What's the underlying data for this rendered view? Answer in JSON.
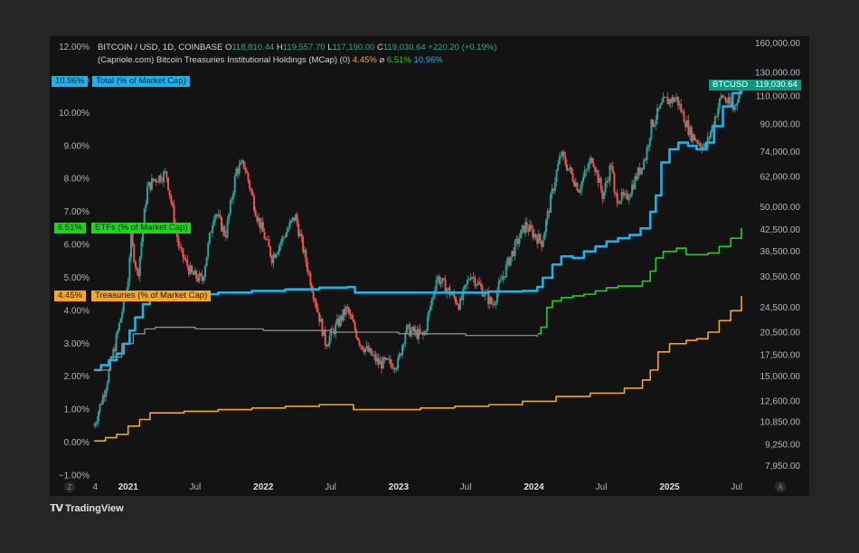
{
  "legend": {
    "line1": {
      "symbol": "BITCOIN / USD, 1D, COINBASE",
      "o_label": "O",
      "o_value": "118,810.44",
      "h_label": "H",
      "h_value": "119,557.70",
      "l_label": "L",
      "l_value": "117,190.00",
      "c_label": "C",
      "c_value": "119,030.64",
      "change": "+220.20 (+0.19%)"
    },
    "line2": {
      "indicator": "(Capriole.com) Bitcoin Treasuries Institutional Holdings (MCap) (0)",
      "v1": "4.45%",
      "sep": "⌀",
      "v2": "6.51%",
      "v3": "10.96%"
    }
  },
  "tags": {
    "total": {
      "value": "10.96%",
      "label": "Total (% of Market Cap)"
    },
    "etf": {
      "value": "6.51%",
      "label": "ETFs (% of Market Cap)"
    },
    "treasury": {
      "value": "4.45%",
      "label": "Treasuries (% of Market Cap)"
    },
    "btc": {
      "symbol": "BTCUSD",
      "value": "119,030.64"
    }
  },
  "brand": "TradingView",
  "nav": {
    "left": "Z",
    "right": "A"
  },
  "colors": {
    "total": "#1eb2ea",
    "etf": "#21d321",
    "treasury": "#f5a623",
    "grey": "#8c8c8c",
    "up": "#26a69a",
    "down": "#ef5350",
    "btc_tag": "#089981"
  },
  "chart_data": {
    "type": "line",
    "x_axis": {
      "labels": [
        "4",
        "2021",
        "Jul",
        "2022",
        "Jul",
        "2023",
        "Jul",
        "2024",
        "Jul",
        "2025",
        "Jul"
      ],
      "range": [
        "2020-10-01",
        "2025-07-14"
      ]
    },
    "left_axis": {
      "ticks": [
        "12.00%",
        "11.00%",
        "10.00%",
        "9.00%",
        "8.00%",
        "7.00%",
        "6.00%",
        "5.00%",
        "4.00%",
        "3.00%",
        "2.00%",
        "1.00%",
        "0.00%",
        "−1.00%"
      ],
      "range": [
        -1,
        12
      ]
    },
    "right_axis": {
      "scale": "log",
      "ticks": [
        "160,000.00",
        "130,000.00",
        "110,000.00",
        "90,000.00",
        "74,000.00",
        "62,000.00",
        "50,000.00",
        "42,500.00",
        "36,500.00",
        "30,500.00",
        "24,500.00",
        "20,500.00",
        "17,500.00",
        "15,000.00",
        "12,600.00",
        "10,850.00",
        "9,250.00",
        "7,950.00"
      ]
    },
    "series": [
      {
        "name": "Total (% of Market Cap)",
        "axis": "left",
        "points": [
          [
            "2020-10-01",
            2.2
          ],
          [
            "2020-10-20",
            2.35
          ],
          [
            "2020-11-10",
            2.5
          ],
          [
            "2020-12-01",
            2.7
          ],
          [
            "2020-12-20",
            3.0
          ],
          [
            "2021-01-05",
            3.4
          ],
          [
            "2021-01-20",
            3.8
          ],
          [
            "2021-02-10",
            4.2
          ],
          [
            "2021-03-01",
            4.5
          ],
          [
            "2021-04-01",
            4.45
          ],
          [
            "2021-06-01",
            4.5
          ],
          [
            "2021-09-01",
            4.55
          ],
          [
            "2021-12-01",
            4.6
          ],
          [
            "2022-03-01",
            4.65
          ],
          [
            "2022-06-01",
            4.7
          ],
          [
            "2022-08-15",
            4.72
          ],
          [
            "2022-09-05",
            4.55
          ],
          [
            "2022-12-01",
            4.55
          ],
          [
            "2023-03-01",
            4.55
          ],
          [
            "2023-06-01",
            4.55
          ],
          [
            "2023-09-01",
            4.58
          ],
          [
            "2023-12-01",
            4.6
          ],
          [
            "2024-01-10",
            4.72
          ],
          [
            "2024-01-25",
            5.0
          ],
          [
            "2024-02-20",
            5.4
          ],
          [
            "2024-03-15",
            5.65
          ],
          [
            "2024-04-15",
            5.6
          ],
          [
            "2024-05-15",
            5.8
          ],
          [
            "2024-06-15",
            5.95
          ],
          [
            "2024-07-15",
            6.1
          ],
          [
            "2024-08-15",
            6.2
          ],
          [
            "2024-09-15",
            6.3
          ],
          [
            "2024-10-15",
            6.5
          ],
          [
            "2024-11-10",
            7.0
          ],
          [
            "2024-11-25",
            7.5
          ],
          [
            "2024-12-10",
            8.5
          ],
          [
            "2025-01-01",
            8.9
          ],
          [
            "2025-01-25",
            9.1
          ],
          [
            "2025-02-20",
            9.0
          ],
          [
            "2025-03-15",
            8.9
          ],
          [
            "2025-04-10",
            9.1
          ],
          [
            "2025-05-01",
            9.6
          ],
          [
            "2025-05-25",
            10.2
          ],
          [
            "2025-06-20",
            10.6
          ],
          [
            "2025-07-14",
            10.96
          ]
        ]
      },
      {
        "name": "ETFs (% of Market Cap)",
        "axis": "left",
        "points": [
          [
            "2024-01-11",
            3.3
          ],
          [
            "2024-01-20",
            3.5
          ],
          [
            "2024-02-05",
            4.1
          ],
          [
            "2024-02-20",
            4.3
          ],
          [
            "2024-03-15",
            4.4
          ],
          [
            "2024-04-15",
            4.45
          ],
          [
            "2024-05-15",
            4.5
          ],
          [
            "2024-06-15",
            4.6
          ],
          [
            "2024-07-15",
            4.7
          ],
          [
            "2024-08-15",
            4.75
          ],
          [
            "2024-09-15",
            4.75
          ],
          [
            "2024-10-20",
            4.9
          ],
          [
            "2024-11-10",
            5.2
          ],
          [
            "2024-11-25",
            5.6
          ],
          [
            "2024-12-15",
            5.8
          ],
          [
            "2025-01-20",
            5.9
          ],
          [
            "2025-02-15",
            5.7
          ],
          [
            "2025-03-15",
            5.7
          ],
          [
            "2025-04-15",
            5.75
          ],
          [
            "2025-05-15",
            5.95
          ],
          [
            "2025-06-15",
            6.2
          ],
          [
            "2025-07-14",
            6.51
          ]
        ]
      },
      {
        "name": "Treasuries (% of Market Cap)",
        "axis": "left",
        "points": [
          [
            "2020-10-01",
            0.05
          ],
          [
            "2020-11-01",
            0.15
          ],
          [
            "2020-12-01",
            0.25
          ],
          [
            "2021-01-01",
            0.5
          ],
          [
            "2021-02-01",
            0.7
          ],
          [
            "2021-03-01",
            0.9
          ],
          [
            "2021-06-01",
            0.95
          ],
          [
            "2021-09-01",
            1.0
          ],
          [
            "2021-12-01",
            1.05
          ],
          [
            "2022-03-01",
            1.1
          ],
          [
            "2022-06-01",
            1.15
          ],
          [
            "2022-09-01",
            1.0
          ],
          [
            "2022-12-01",
            1.0
          ],
          [
            "2023-03-01",
            1.05
          ],
          [
            "2023-06-01",
            1.1
          ],
          [
            "2023-09-01",
            1.15
          ],
          [
            "2023-12-01",
            1.25
          ],
          [
            "2024-03-01",
            1.4
          ],
          [
            "2024-06-01",
            1.5
          ],
          [
            "2024-09-01",
            1.65
          ],
          [
            "2024-10-20",
            1.9
          ],
          [
            "2024-11-10",
            2.2
          ],
          [
            "2024-12-01",
            2.75
          ],
          [
            "2025-01-01",
            3.0
          ],
          [
            "2025-02-15",
            3.1
          ],
          [
            "2025-03-15",
            3.15
          ],
          [
            "2025-04-15",
            3.35
          ],
          [
            "2025-05-15",
            3.7
          ],
          [
            "2025-06-15",
            4.0
          ],
          [
            "2025-07-14",
            4.45
          ]
        ]
      },
      {
        "name": "",
        "axis": "left",
        "points": [
          [
            "2020-10-01",
            2.2
          ],
          [
            "2020-11-15",
            2.6
          ],
          [
            "2020-12-15",
            3.0
          ],
          [
            "2021-01-15",
            3.3
          ],
          [
            "2021-02-15",
            3.45
          ],
          [
            "2021-03-15",
            3.5
          ],
          [
            "2021-07-01",
            3.45
          ],
          [
            "2022-01-01",
            3.4
          ],
          [
            "2022-07-01",
            3.35
          ],
          [
            "2023-01-01",
            3.3
          ],
          [
            "2023-07-01",
            3.25
          ],
          [
            "2024-01-10",
            3.2
          ]
        ]
      },
      {
        "name": "BTCUSD",
        "axis": "right",
        "type": "candlestick",
        "anchors": [
          [
            "2020-10-01",
            10600
          ],
          [
            "2020-10-31",
            13800
          ],
          [
            "2020-11-30",
            19600
          ],
          [
            "2020-12-31",
            29000
          ],
          [
            "2021-01-08",
            40500
          ],
          [
            "2021-01-27",
            30500
          ],
          [
            "2021-02-21",
            57000
          ],
          [
            "2021-03-13",
            61000
          ],
          [
            "2021-04-14",
            63500
          ],
          [
            "2021-05-19",
            37000
          ],
          [
            "2021-06-22",
            31000
          ],
          [
            "2021-07-20",
            29800
          ],
          [
            "2021-08-22",
            49000
          ],
          [
            "2021-09-21",
            41000
          ],
          [
            "2021-10-20",
            65000
          ],
          [
            "2021-11-10",
            68000
          ],
          [
            "2021-12-15",
            47000
          ],
          [
            "2022-01-24",
            35000
          ],
          [
            "2022-03-28",
            47000
          ],
          [
            "2022-05-12",
            28500
          ],
          [
            "2022-06-18",
            19000
          ],
          [
            "2022-08-14",
            24300
          ],
          [
            "2022-09-20",
            19000
          ],
          [
            "2022-11-09",
            16500
          ],
          [
            "2022-12-30",
            16500
          ],
          [
            "2023-01-20",
            21000
          ],
          [
            "2023-03-10",
            20000
          ],
          [
            "2023-04-14",
            30500
          ],
          [
            "2023-06-15",
            25000
          ],
          [
            "2023-07-14",
            31300
          ],
          [
            "2023-09-11",
            25000
          ],
          [
            "2023-10-24",
            34000
          ],
          [
            "2023-12-08",
            44000
          ],
          [
            "2024-01-23",
            39000
          ],
          [
            "2024-02-28",
            62000
          ],
          [
            "2024-03-14",
            73000
          ],
          [
            "2024-05-01",
            57000
          ],
          [
            "2024-06-07",
            71500
          ],
          [
            "2024-07-05",
            54000
          ],
          [
            "2024-07-29",
            69000
          ],
          [
            "2024-08-05",
            54000
          ],
          [
            "2024-09-06",
            53000
          ],
          [
            "2024-10-29",
            72000
          ],
          [
            "2024-11-12",
            89000
          ],
          [
            "2024-12-17",
            106000
          ],
          [
            "2025-01-20",
            108000
          ],
          [
            "2025-02-27",
            84000
          ],
          [
            "2025-04-08",
            76000
          ],
          [
            "2025-05-22",
            111000
          ],
          [
            "2025-06-22",
            100000
          ],
          [
            "2025-07-14",
            119030.64
          ]
        ]
      }
    ]
  }
}
